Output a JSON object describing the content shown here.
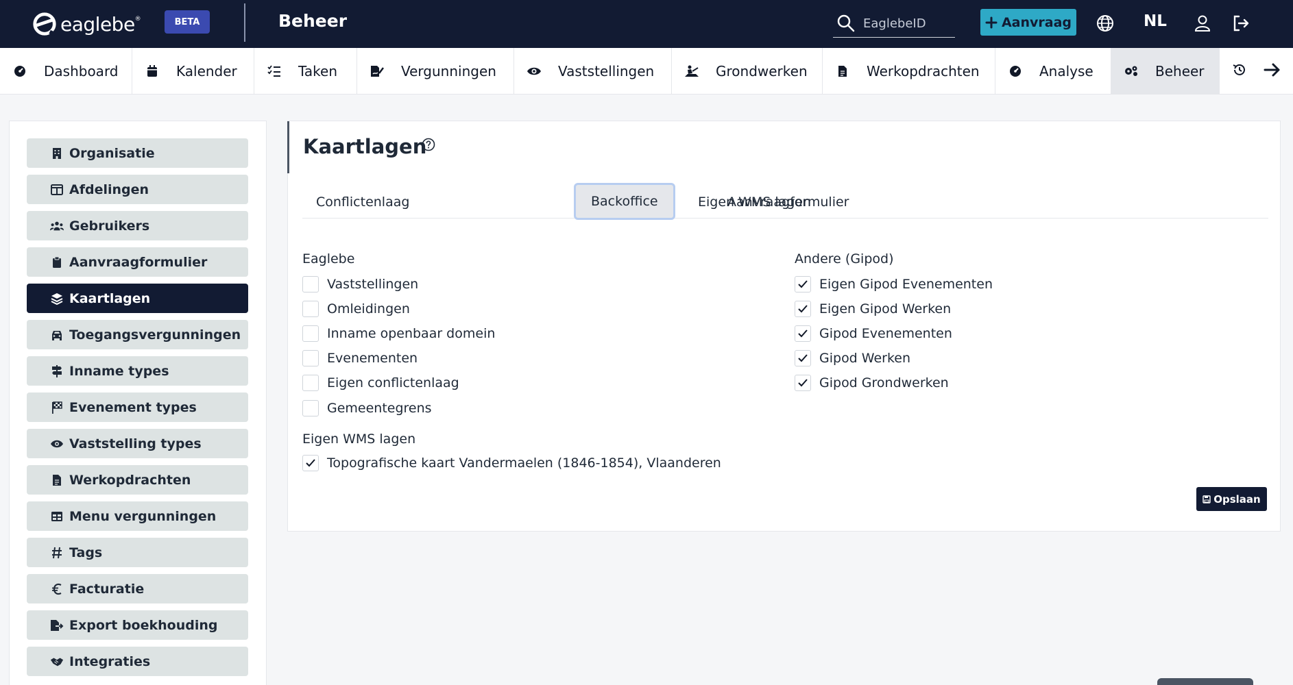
{
  "header": {
    "brand": "eaglebe",
    "badge": "BETA",
    "app_title": "Beheer",
    "search": {
      "placeholder": "EaglebeID",
      "value": ""
    },
    "new_request_label": "Aanvraag",
    "language": "NL",
    "icons": [
      "search-icon",
      "plus-icon",
      "globe-icon",
      "user-icon",
      "logout-icon"
    ]
  },
  "nav": {
    "items": [
      {
        "label": "Dashboard",
        "icon": "gauge-icon"
      },
      {
        "label": "Kalender",
        "icon": "calendar-icon"
      },
      {
        "label": "Taken",
        "icon": "checklist-icon"
      },
      {
        "label": "Vergunningen",
        "icon": "file-signature-icon"
      },
      {
        "label": "Vaststellingen",
        "icon": "eye-icon"
      },
      {
        "label": "Grondwerken",
        "icon": "digging-icon"
      },
      {
        "label": "Werkopdrachten",
        "icon": "document-icon"
      },
      {
        "label": "Analyse",
        "icon": "gauge-icon"
      },
      {
        "label": "Beheer",
        "icon": "gears-icon",
        "active": true
      }
    ],
    "extra_icons": [
      "history-icon",
      "arrow-right-icon"
    ]
  },
  "sidebar": {
    "items": [
      {
        "label": "Organisatie",
        "icon": "building-icon"
      },
      {
        "label": "Afdelingen",
        "icon": "columns-icon"
      },
      {
        "label": "Gebruikers",
        "icon": "users-icon"
      },
      {
        "label": "Aanvraagformulier",
        "icon": "clipboard-icon"
      },
      {
        "label": "Kaartlagen",
        "icon": "layers-icon",
        "active": true
      },
      {
        "label": "Toegangsvergunningen",
        "icon": "car-icon"
      },
      {
        "label": "Inname types",
        "icon": "signpost-icon"
      },
      {
        "label": "Evenement types",
        "icon": "flag-checkered-icon"
      },
      {
        "label": "Vaststelling types",
        "icon": "eye-icon"
      },
      {
        "label": "Werkopdrachten",
        "icon": "document-icon"
      },
      {
        "label": "Menu vergunningen",
        "icon": "table-icon"
      },
      {
        "label": "Tags",
        "icon": "hashtag-icon"
      },
      {
        "label": "Facturatie",
        "icon": "euro-icon"
      },
      {
        "label": "Export boekhouding",
        "icon": "file-export-icon"
      },
      {
        "label": "Integraties",
        "icon": "handshake-icon"
      }
    ]
  },
  "main": {
    "title": "Kaartlagen",
    "tabs": [
      {
        "label": "Conflictenlaag"
      },
      {
        "label": "Aanvraagformulier"
      },
      {
        "label": "Backoffice",
        "active": true
      },
      {
        "label": "Eigen WMS lagen"
      }
    ],
    "groups": {
      "eaglebe": {
        "title": "Eaglebe",
        "items": [
          {
            "label": "Vaststellingen",
            "checked": false
          },
          {
            "label": "Omleidingen",
            "checked": false
          },
          {
            "label": "Inname openbaar domein",
            "checked": false
          },
          {
            "label": "Evenementen",
            "checked": false
          },
          {
            "label": "Eigen conflictenlaag",
            "checked": false
          },
          {
            "label": "Gemeentegrens",
            "checked": false
          }
        ]
      },
      "andere": {
        "title": "Andere (Gipod)",
        "items": [
          {
            "label": "Eigen Gipod Evenementen",
            "checked": true
          },
          {
            "label": "Eigen Gipod Werken",
            "checked": true
          },
          {
            "label": "Gipod Evenementen",
            "checked": true
          },
          {
            "label": "Gipod Werken",
            "checked": true
          },
          {
            "label": "Gipod Grondwerken",
            "checked": true
          }
        ]
      },
      "wms": {
        "title": "Eigen WMS lagen",
        "items": [
          {
            "label": "Topografische kaart Vandermaelen (1846-1854), Vlaanderen",
            "checked": true
          }
        ]
      }
    },
    "save_label": "Opslaan"
  },
  "colors": {
    "header_bg": "#121b33",
    "accent_teal": "#2ea9c6",
    "badge_blue": "#3b4ab0",
    "sidebar_item_bg": "#dde3e3",
    "active_tab_border": "#b7cdf0"
  }
}
